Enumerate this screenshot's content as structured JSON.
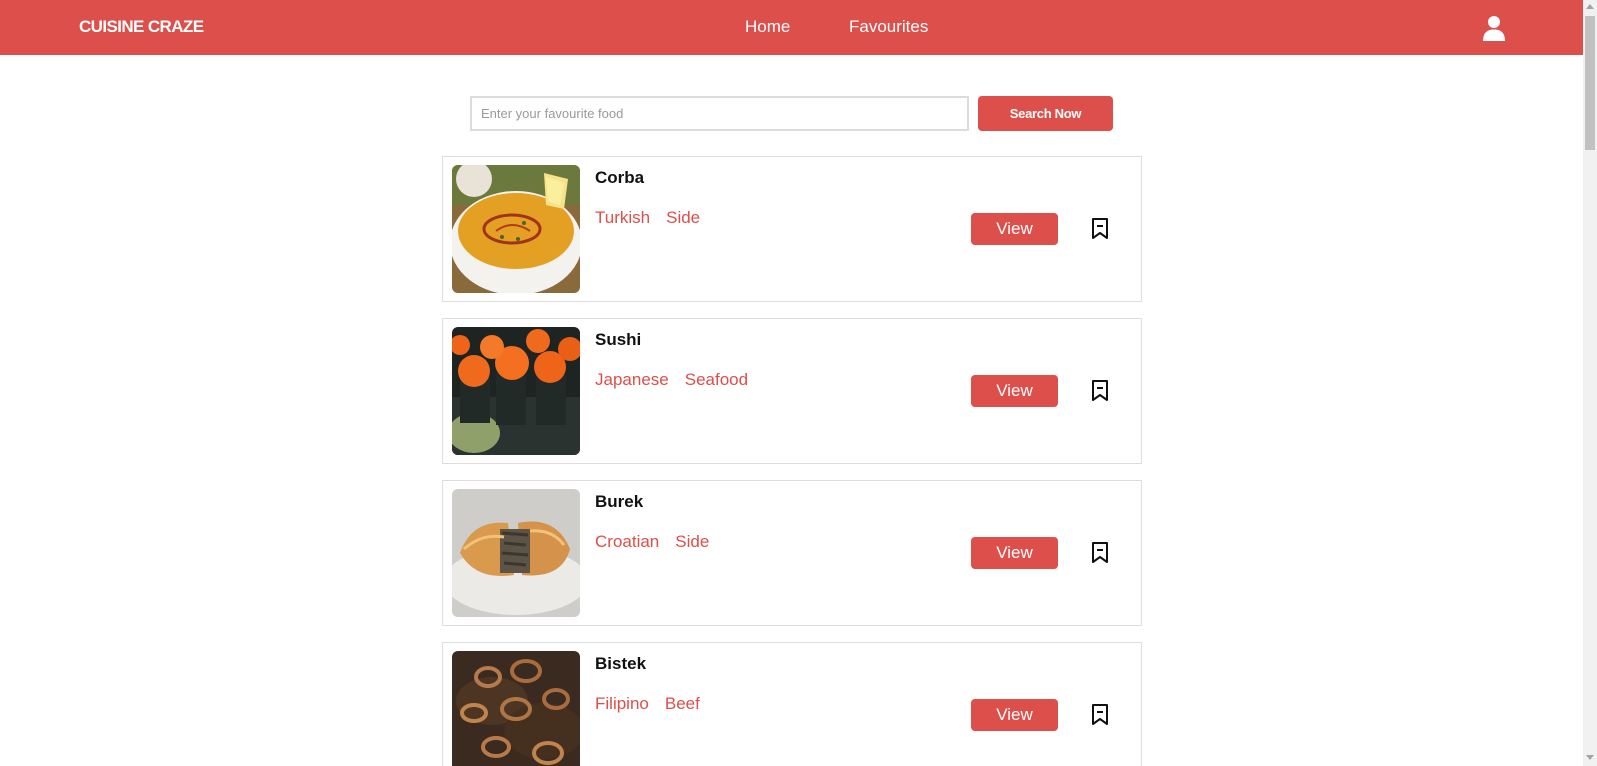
{
  "brand": "CUISINE CRAZE",
  "nav": {
    "home": "Home",
    "favourites": "Favourites",
    "user_icon": "user-icon"
  },
  "search": {
    "placeholder": "Enter your favourite food",
    "value": "",
    "button_label": "Search Now"
  },
  "meals": [
    {
      "name": "Corba",
      "tags": [
        "Turkish",
        "Side"
      ],
      "view_label": "View",
      "icon": "bookmark-icon"
    },
    {
      "name": "Sushi",
      "tags": [
        "Japanese",
        "Seafood"
      ],
      "view_label": "View",
      "icon": "bookmark-icon"
    },
    {
      "name": "Burek",
      "tags": [
        "Croatian",
        "Side"
      ],
      "view_label": "View",
      "icon": "bookmark-icon"
    },
    {
      "name": "Bistek",
      "tags": [
        "Filipino",
        "Beef"
      ],
      "view_label": "View",
      "icon": "bookmark-icon"
    }
  ],
  "colors": {
    "accent": "#dc4f4a",
    "card_border": "#dedede",
    "text": "#111111"
  }
}
